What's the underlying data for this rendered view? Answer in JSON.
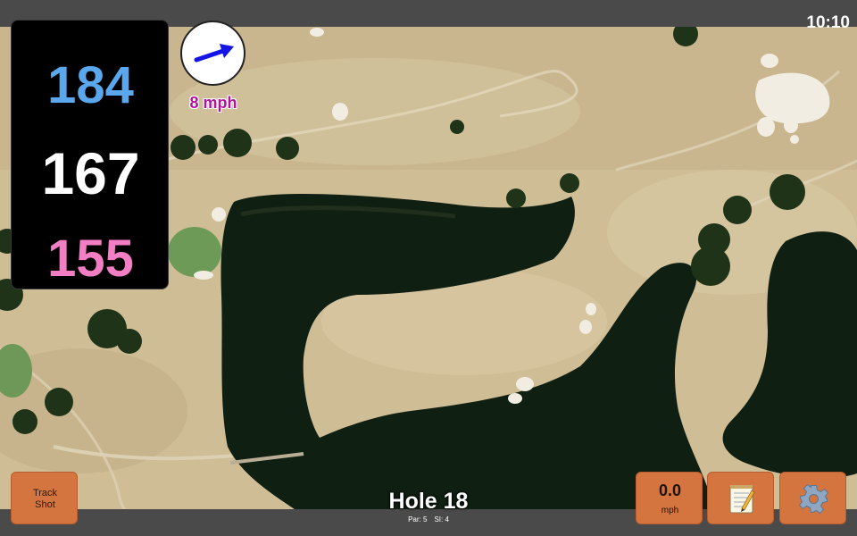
{
  "status_bar": {
    "time": "10:10"
  },
  "distances": {
    "back": "184",
    "middle": "167",
    "front": "155"
  },
  "wind": {
    "speed": "8 mph",
    "icon": "wind-arrow-icon"
  },
  "hole": {
    "title": "Hole 18",
    "par": "Par: 5",
    "stroke_index": "SI: 4"
  },
  "buttons": {
    "track_shot_line1": "Track",
    "track_shot_line2": "Shot",
    "speed_value": "0.0",
    "speed_unit": "mph",
    "notes_icon": "notepad-icon",
    "settings_icon": "gear-icon"
  },
  "colors": {
    "back": "#5aa7ee",
    "middle": "#ffffff",
    "front": "#f47ec4",
    "wind_text": "#b0139e",
    "button": "#d4743f"
  }
}
